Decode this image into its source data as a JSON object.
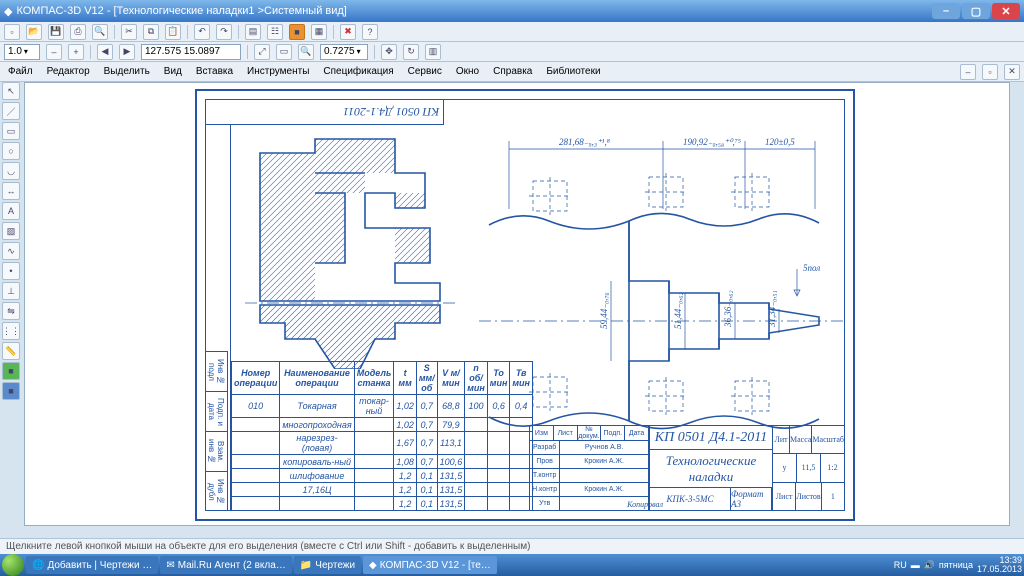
{
  "window": {
    "title": "КОМПАС-3D V12 - [Технологические наладки1 >Системный вид]"
  },
  "menu": [
    "Файл",
    "Редактор",
    "Выделить",
    "Вид",
    "Вставка",
    "Инструменты",
    "Спецификация",
    "Сервис",
    "Окно",
    "Справка",
    "Библиотеки"
  ],
  "toolbar": {
    "scale": "1.0",
    "coords": "127.575  15.0897",
    "zoom": "0.7275"
  },
  "drawing": {
    "doc_code_top": "КП 0501 Д4.1-2011",
    "dims": {
      "d1": "281,68₋₉,₃⁺¹,⁸",
      "d2": "190,92₋₀,₅₈⁺⁰,⁷⁵",
      "d3": "120±0,5",
      "v1": "59,44₋₀,₇₆",
      "v2": "51,44₋₀,₆₂",
      "v3": "36,36₋₀,₆₂",
      "v4": "31,34₋₀,₅₁"
    },
    "knurl_label": "5пол"
  },
  "op_table": {
    "headers": [
      "Номер операции",
      "Наименование операции",
      "Модель станка",
      "t мм",
      "S мм/об",
      "V м/мин",
      "n об/мин",
      "To мин",
      "Тв мин"
    ],
    "rows": [
      [
        "010",
        "Токарная",
        "токар-ный",
        "1,02",
        "0,7",
        "68,8",
        "100",
        "0,6",
        "0,4"
      ],
      [
        "",
        "многопроходная",
        "",
        "1,02",
        "0,7",
        "79,9",
        "",
        "",
        ""
      ],
      [
        "",
        "нарезрез-(ловая)",
        "",
        "1,67",
        "0,7",
        "113,1",
        "",
        "",
        ""
      ],
      [
        "",
        "копироваль-ный",
        "",
        "1,08",
        "0,7",
        "100,6",
        "",
        "",
        ""
      ],
      [
        "",
        "шлифование",
        "",
        "1,2",
        "0,1",
        "131,5",
        "",
        "",
        ""
      ],
      [
        "",
        "17,16Ц",
        "",
        "1,2",
        "0,1",
        "131,5",
        "",
        "",
        ""
      ],
      [
        "",
        "",
        "",
        "1,2",
        "0,1",
        "131,5",
        "",
        "",
        ""
      ]
    ]
  },
  "titleblock": {
    "code": "КП 0501 Д4.1-2011",
    "title": "Технологические наладки",
    "model": "КПК-3-5МС",
    "format": "Формат   A3",
    "lit": "у",
    "mass": "11,5",
    "scale": "1:2",
    "left_rows": [
      [
        "Изм",
        "Лист",
        "№ докум.",
        "Подп.",
        "Дата"
      ],
      [
        "Разраб",
        "Ручнов А.В.",
        "",
        "",
        ""
      ],
      [
        "Пров",
        "Крокин А.Ж.",
        "",
        "",
        ""
      ],
      [
        "Т.контр",
        "",
        "",
        "",
        ""
      ],
      [
        "",
        "",
        "",
        "",
        ""
      ],
      [
        "Н.контр",
        "Крокин А.Ж.",
        "",
        "",
        ""
      ],
      [
        "Утв",
        "",
        "",
        "",
        ""
      ]
    ],
    "right_hdr": [
      "Лит",
      "Масса",
      "Масштаб"
    ],
    "sheet_row": [
      "Лист",
      "Листов",
      "1"
    ],
    "copy": "Копировал"
  },
  "statusbar": "Щелкните левой кнопкой мыши на объекте для его выделения (вместе с Ctrl или Shift - добавить к выделенным)",
  "taskbar": {
    "items": [
      "Добавить | Чертежи …",
      "Mail.Ru Агент (2 вкла…",
      "Чертежи",
      "КОМПАС-3D V12 - [те…"
    ],
    "time": "13:39",
    "date": "17.05.2013",
    "day": "пятница"
  }
}
